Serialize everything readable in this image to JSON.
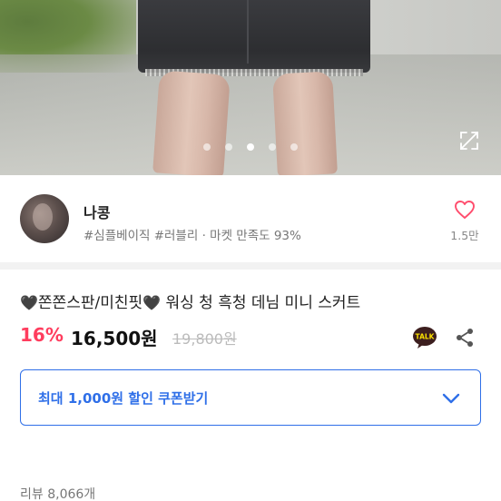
{
  "hero": {
    "image_alt": "",
    "carousel_total": 5,
    "carousel_active": 3
  },
  "seller": {
    "name": "나콩",
    "tags": "#심플베이직 #러블리 · 마켓 만족도 93%",
    "like_count": "1.5만"
  },
  "product": {
    "title_prefix_icon": "🖤",
    "title_main": "쫀쫀스판/미친핏",
    "title_mid_icon": "🖤",
    "title_rest": " 워싱 청 흑청 데님 미니 스커트",
    "discount": "16%",
    "price": "16,500원",
    "original_price": "19,800원"
  },
  "coupon": {
    "label": "최대 1,000원 할인 쿠폰받기"
  },
  "reviews": {
    "label": "리뷰 8,066개"
  },
  "icons": {
    "expand": "expand-icon",
    "heart": "heart-outline-icon",
    "talk": "kakaotalk-icon",
    "share": "share-icon",
    "chevron": "chevron-down-icon"
  },
  "colors": {
    "accent_blue": "#2f6fe8",
    "discount_red": "#ff3d5e",
    "heart_pink": "#ff4d6d",
    "talk_yellow": "#3c1e1e"
  }
}
